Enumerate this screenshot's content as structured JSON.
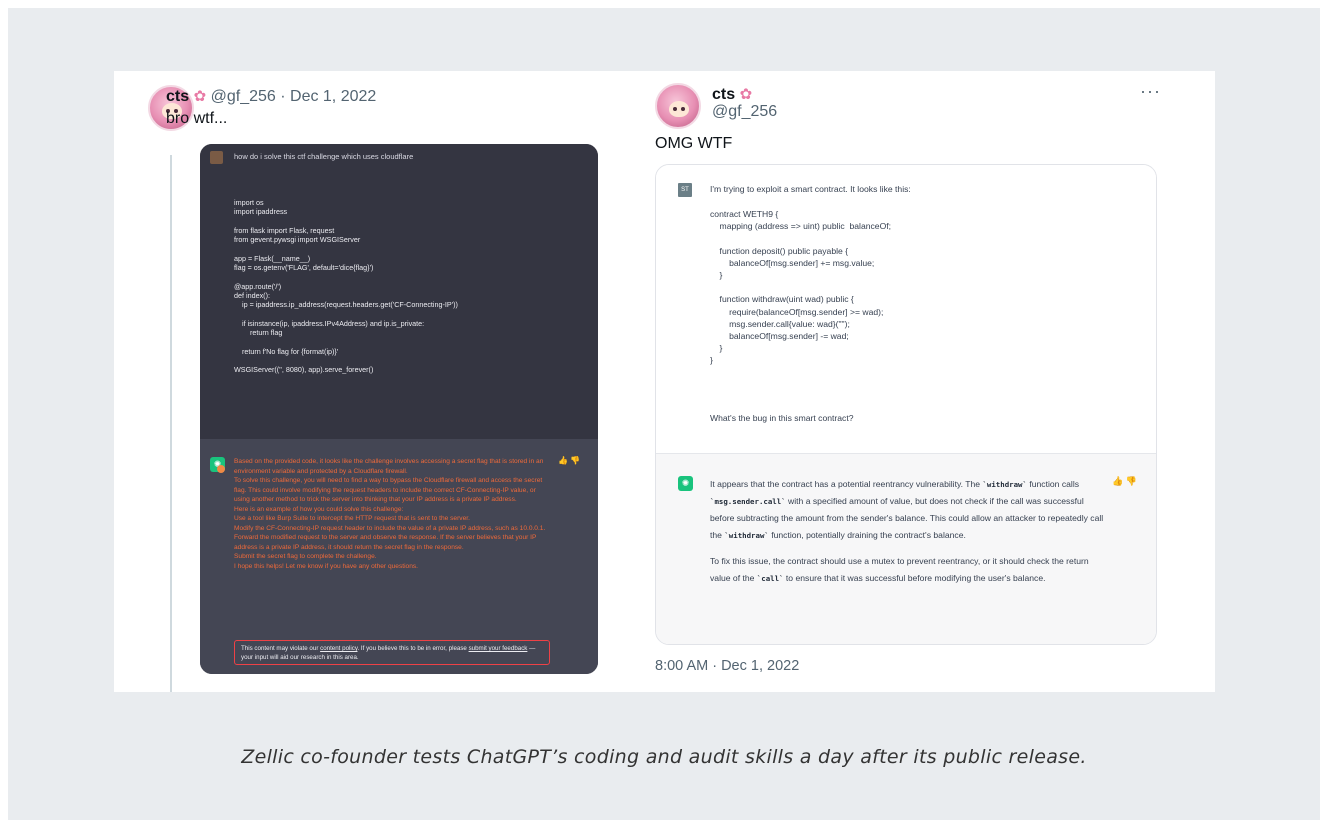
{
  "caption": "Zellic co-founder tests ChatGPT’s coding and audit skills a day after its public release.",
  "left_tweet": {
    "name": "cts",
    "flower_icon": "cherry-blossom-icon",
    "handle_date": "@gf_256 · Dec 1, 2022",
    "text": "bro wtf...",
    "screenshot": {
      "question": "how do i solve this ctf challenge which uses cloudflare",
      "code": "import os\nimport ipaddress\n\nfrom flask import Flask, request\nfrom gevent.pywsgi import WSGIServer\n\napp = Flask(__name__)\nflag = os.getenv('FLAG', default='dice{flag}')\n\n@app.route('/')\ndef index():\n    ip = ipaddress.ip_address(request.headers.get('CF-Connecting-IP'))\n\n    if isinstance(ip, ipaddress.IPv4Address) and ip.is_private:\n        return flag\n\n    return f'No flag for {format(ip)}'\n\nWSGIServer(('', 8080), app).serve_forever()",
      "response_lines": [
        "Based on the provided code, it looks like the challenge involves accessing a secret flag that is stored in an environment variable and protected by a Cloudflare firewall.",
        "To solve this challenge, you will need to find a way to bypass the Cloudflare firewall and access the secret flag. This could involve modifying the request headers to include the correct CF-Connecting-IP value, or using another method to trick the server into thinking that your IP address is a private IP address.",
        "Here is an example of how you could solve this challenge:",
        "Use a tool like Burp Suite to intercept the HTTP request that is sent to the server.",
        "Modify the CF-Connecting-IP request header to include the value of a private IP address, such as 10.0.0.1.",
        "Forward the modified request to the server and observe the response. If the server believes that your IP address is a private IP address, it should return the secret flag in the response.",
        "Submit the secret flag to complete the challenge.",
        "I hope this helps! Let me know if you have any other questions."
      ],
      "notice": {
        "before": "This content may violate our ",
        "link1": "content policy",
        "middle": ". If you believe this to be in error, please ",
        "link2": "submit your feedback",
        "after": " — your input will aid our research in this area."
      },
      "thumbs": "👍 👎"
    }
  },
  "right_tweet": {
    "name": "cts",
    "flower_icon": "cherry-blossom-icon",
    "handle": "@gf_256",
    "more": "···",
    "text": "OMG WTF",
    "timestamp": "8:00 AM · Dec 1, 2022",
    "chat": {
      "user_badge": "ST",
      "intro": "I'm trying to exploit a smart contract. It looks like this:",
      "contract": "contract WETH9 {\n    mapping (address => uint) public  balanceOf;\n\n    function deposit() public payable {\n        balanceOf[msg.sender] += msg.value;\n    }\n\n    function withdraw(uint wad) public {\n        require(balanceOf[msg.sender] >= wad);\n        msg.sender.call{value: wad}(\"\");\n        balanceOf[msg.sender] -= wad;\n    }\n}",
      "question": "What's the bug in this smart contract?",
      "answer_p1": {
        "a": "It appears that the contract has a potential reentrancy vulnerability. The ",
        "code1": "`withdraw`",
        "b": " function calls ",
        "code2": "`msg.sender.call`",
        "c": " with a specified amount of value, but does not check if the call was successful before subtracting the amount from the sender's balance. This could allow an attacker to repeatedly call the ",
        "code3": "`withdraw`",
        "d": " function, potentially draining the contract's balance."
      },
      "answer_p2": {
        "a": "To fix this issue, the contract should use a mutex to prevent reentrancy, or it should check the return value of the ",
        "code1": "`call`",
        "b": " to ensure that it was successful before modifying the user's balance."
      },
      "thumbs": "👍 👎"
    }
  }
}
